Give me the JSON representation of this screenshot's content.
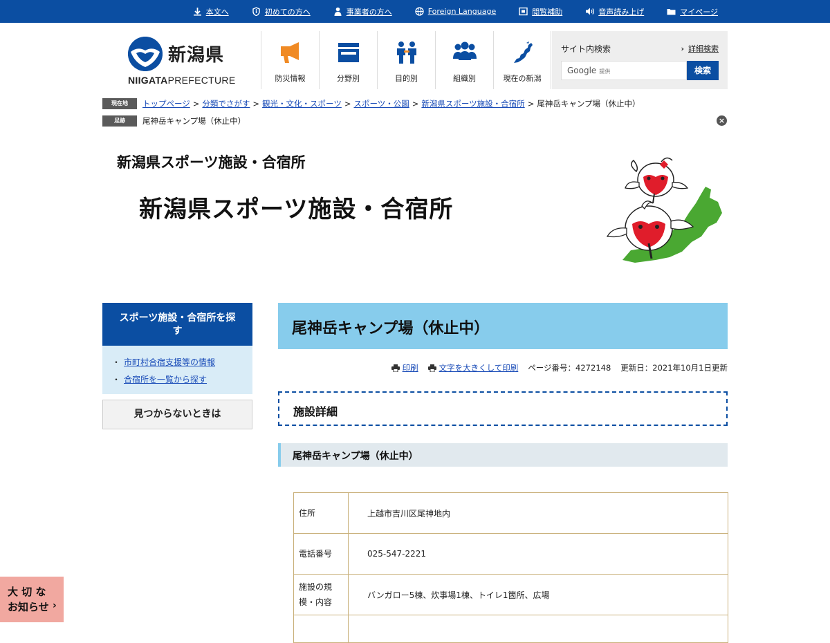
{
  "topbar": {
    "links": [
      {
        "label": "本文へ",
        "icon": "arrow-down-icon"
      },
      {
        "label": "初めての方へ",
        "icon": "info-shield-icon"
      },
      {
        "label": "事業者の方へ",
        "icon": "person-icon"
      },
      {
        "label": "Foreign Language",
        "icon": "globe-icon"
      },
      {
        "label": "閲覧補助",
        "icon": "display-icon"
      },
      {
        "label": "音声読み上げ",
        "icon": "speaker-icon"
      },
      {
        "label": "マイページ",
        "icon": "folder-icon"
      }
    ]
  },
  "logo": {
    "title": "新潟県",
    "sub_bold": "NIIGATA",
    "sub_rest": "PREFECTURE"
  },
  "nav": [
    {
      "label": "防災情報",
      "icon": "megaphone-icon",
      "color": "#f08a24"
    },
    {
      "label": "分野別",
      "icon": "tray-icon",
      "color": "#0b4ea2"
    },
    {
      "label": "目的別",
      "icon": "two-people-icon",
      "color": "#0b4ea2"
    },
    {
      "label": "組織別",
      "icon": "group-icon",
      "color": "#0b4ea2"
    },
    {
      "label": "現在の新潟",
      "icon": "niigata-map-icon",
      "color": "#0b4ea2"
    }
  ],
  "search": {
    "label": "サイト内検索",
    "advanced": "詳細検索",
    "google_text": "Google",
    "provided": "提供",
    "button": "検索"
  },
  "breadcrumb": {
    "tag": "現在地",
    "links": [
      "トップページ",
      "分類でさがす",
      "観光・文化・スポーツ",
      "スポーツ・公園",
      "新潟県スポーツ施設・合宿所"
    ],
    "current": "尾神岳キャンプ場（休止中）",
    "separator": ">"
  },
  "footprint": {
    "tag": "足跡",
    "item": "尾神岳キャンプ場（休止中）"
  },
  "banner": {
    "small": "新潟県スポーツ施設・合宿所",
    "big": "新潟県スポーツ施設・合宿所"
  },
  "sidebar": {
    "heading": "スポーツ施設・合宿所を探す",
    "items": [
      "市町村合宿支援等の情報",
      "合宿所を一覧から探す"
    ],
    "button": "見つからないときは"
  },
  "main": {
    "title": "尾神岳キャンプ場（休止中）",
    "print": "印刷",
    "print_large": "文字を大きくして印刷",
    "page_number": "ページ番号：4272148",
    "updated": "更新日：2021年10月1日更新",
    "section": "施設詳細",
    "subsection": "尾神岳キャンプ場（休止中）"
  },
  "table": {
    "rows": [
      {
        "key": "住所",
        "value": "上越市吉川区尾神地内"
      },
      {
        "key": "電話番号",
        "value": "025-547-2221"
      },
      {
        "key": "施設の規模・内容",
        "value": "バンガロー5棟、炊事場1棟、トイレ1箇所、広場"
      },
      {
        "key": "",
        "value": ""
      }
    ]
  },
  "notice": {
    "line1": "大 切 な",
    "line2": "お知らせ",
    "arrow": "›"
  },
  "colors": {
    "primary": "#0b4ea2",
    "title_bg": "#87ccec",
    "sidebar_bg": "#d9ecf7",
    "notice_bg": "#f1a8a0",
    "table_border": "#c9b07a"
  }
}
